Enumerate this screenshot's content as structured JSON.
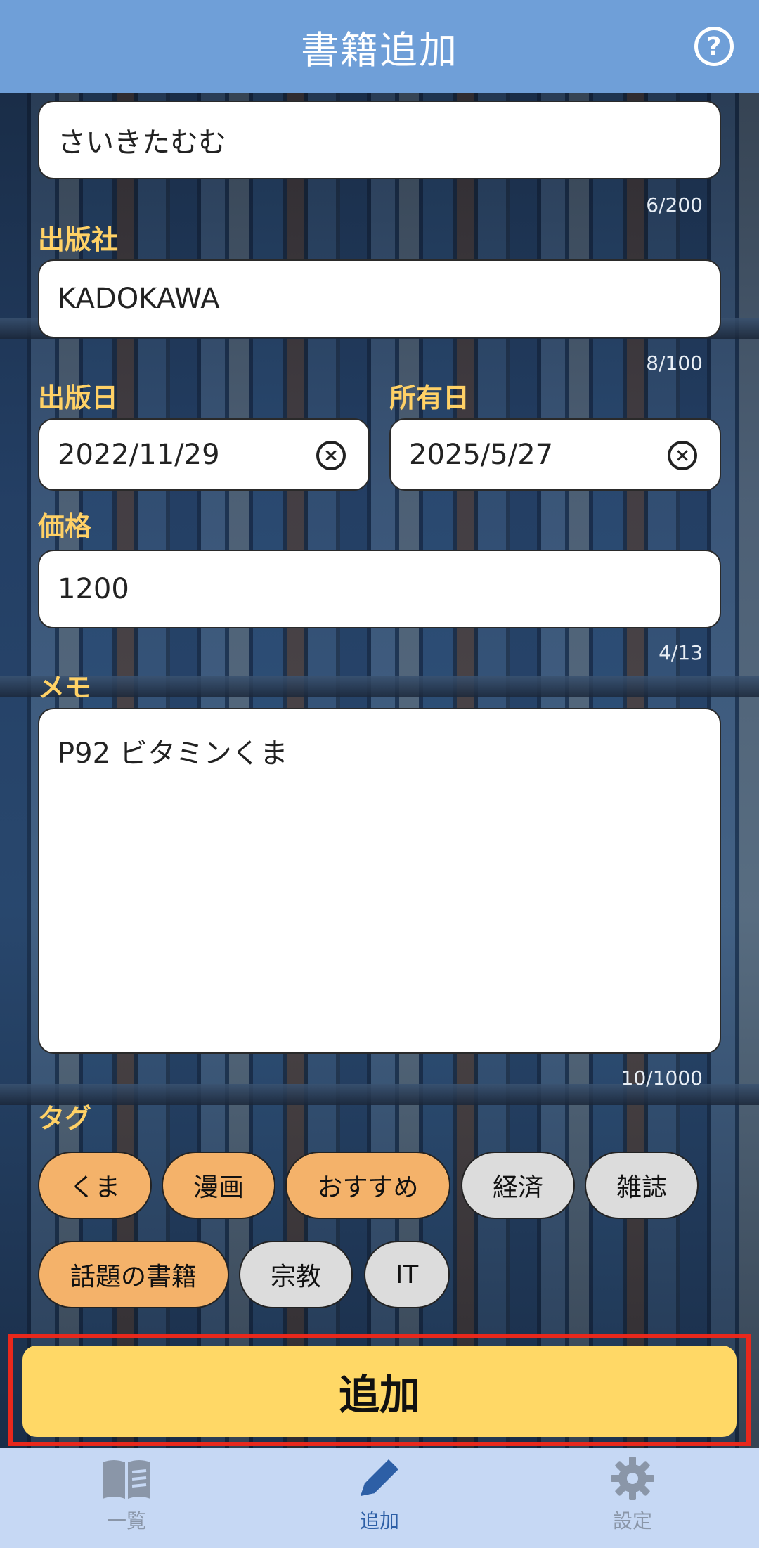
{
  "header": {
    "title": "書籍追加",
    "help_icon": "help-icon"
  },
  "form": {
    "author": {
      "value": "さいきたむむ",
      "counter": "6/200"
    },
    "publisher": {
      "label": "出版社",
      "value": "KADOKAWA",
      "counter": "8/100"
    },
    "publish_date": {
      "label": "出版日",
      "value": "2022/11/29"
    },
    "own_date": {
      "label": "所有日",
      "value": "2025/5/27"
    },
    "price": {
      "label": "価格",
      "value": "1200",
      "counter": "4/13"
    },
    "memo": {
      "label": "メモ",
      "value": "P92 ビタミンくま",
      "counter": "10/1000"
    },
    "tags": {
      "label": "タグ",
      "items": [
        {
          "name": "くま",
          "selected": true
        },
        {
          "name": "漫画",
          "selected": true
        },
        {
          "name": "おすすめ",
          "selected": true
        },
        {
          "name": "経済",
          "selected": false
        },
        {
          "name": "雑誌",
          "selected": false
        },
        {
          "name": "話題の書籍",
          "selected": true
        },
        {
          "name": "宗教",
          "selected": false
        },
        {
          "name": "IT",
          "selected": false
        }
      ]
    },
    "submit_label": "追加"
  },
  "colors": {
    "header": "#6f9fd8",
    "label": "#ffd166",
    "tag_on": "#f4b26a",
    "tag_off": "#dcdcdc",
    "submit": "#ffd866",
    "nav_bg": "#c6d8f4",
    "nav_active": "#2d5fa6",
    "nav_inactive": "#8a96a8"
  },
  "bottom_nav": [
    {
      "label": "一覧",
      "icon": "book-icon",
      "active": false
    },
    {
      "label": "追加",
      "icon": "pencil-icon",
      "active": true
    },
    {
      "label": "設定",
      "icon": "gear-icon",
      "active": false
    }
  ]
}
